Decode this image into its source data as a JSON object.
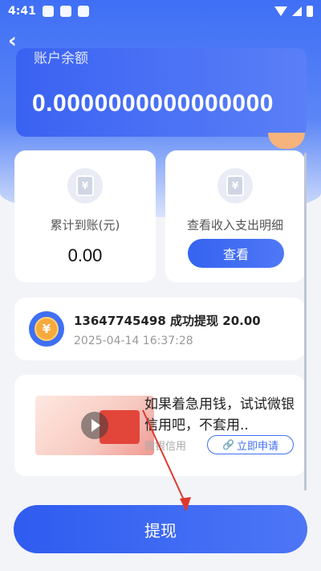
{
  "status_bar": {
    "time": "4:41"
  },
  "balance": {
    "label": "账户余额",
    "value": "0.0000000000000000"
  },
  "stats": {
    "cumulative": {
      "title": "累计到账(元)",
      "value": "0.00"
    },
    "details": {
      "title": "查看收入支出明细",
      "button": "查看"
    }
  },
  "record": {
    "title": "13647745498 成功提现 20.00",
    "time": "2025-04-14 16:37:28"
  },
  "ad": {
    "text": "如果着急用钱，试试微银信用吧，不套用..",
    "source": "微银信用",
    "apply": "立即申请"
  },
  "footer": {
    "withdraw": "提现"
  },
  "icons": {
    "coin": "yen-coin-icon",
    "back": "back-arrow-icon"
  },
  "colors": {
    "primary": "#3f6ff5",
    "arrow": "#e0372c"
  }
}
